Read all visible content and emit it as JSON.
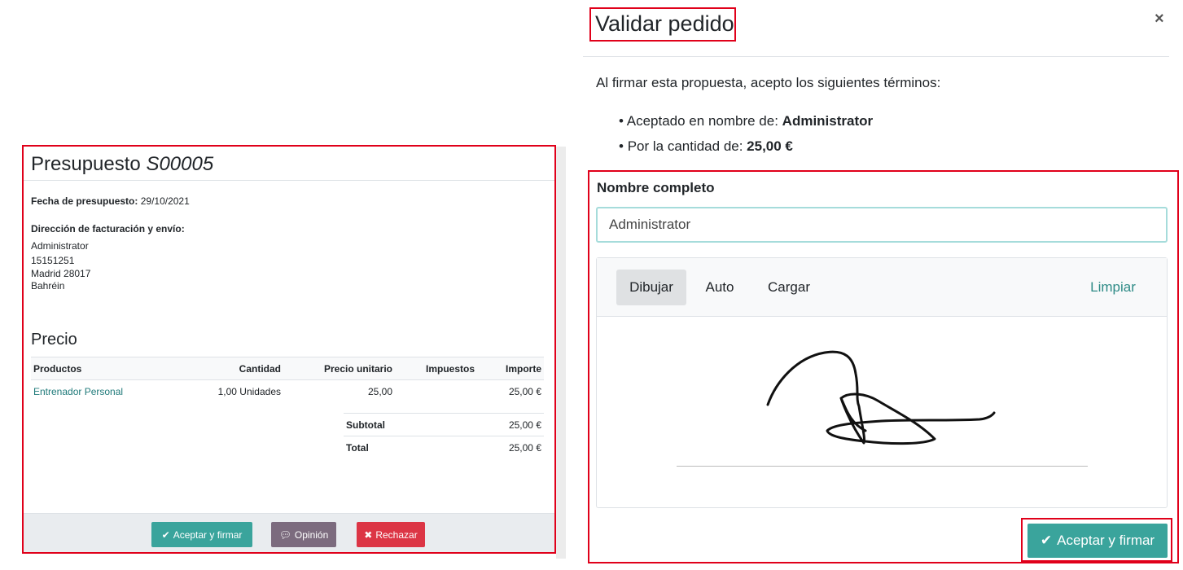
{
  "quote": {
    "title_prefix": "Presupuesto",
    "title_number": "S00005",
    "date_label": "Fecha de presupuesto:",
    "date_value": "29/10/2021",
    "address_label": "Dirección de facturación y envío:",
    "address_lines": [
      "Administrator",
      "15151251",
      "Madrid 28017",
      "Bahréin"
    ],
    "price_heading": "Precio",
    "columns": [
      "Productos",
      "Cantidad",
      "Precio unitario",
      "Impuestos",
      "Importe"
    ],
    "rows": [
      {
        "product": "Entrenador Personal",
        "qty": "1,00 Unidades",
        "unit_price": "25,00",
        "taxes": "",
        "amount": "25,00 €"
      }
    ],
    "subtotal_label": "Subtotal",
    "subtotal_value": "25,00 €",
    "total_label": "Total",
    "total_value": "25,00 €",
    "buttons": {
      "accept": "Aceptar y firmar",
      "feedback": "Opinión",
      "reject": "Rechazar"
    }
  },
  "dialog": {
    "title": "Validar pedido",
    "close": "×",
    "terms_intro": "Al firmar esta propuesta, acepto los siguientes términos:",
    "accepted_for_label": "Aceptado en nombre de: ",
    "accepted_for_value": "Administrator",
    "amount_label": "Por la cantidad de: ",
    "amount_value": "25,00 €",
    "name_label": "Nombre completo",
    "name_value": "Administrator",
    "tabs": {
      "draw": "Dibujar",
      "auto": "Auto",
      "load": "Cargar",
      "clear": "Limpiar"
    },
    "accept_button": "Aceptar y firmar"
  },
  "icons": {
    "check": "check-icon",
    "comment": "comment-icon",
    "cross": "times-icon"
  },
  "colors": {
    "accent": "#3aa49c",
    "danger": "#dc3545",
    "muted_button": "#7c6b7e",
    "highlight": "#e0001a"
  }
}
